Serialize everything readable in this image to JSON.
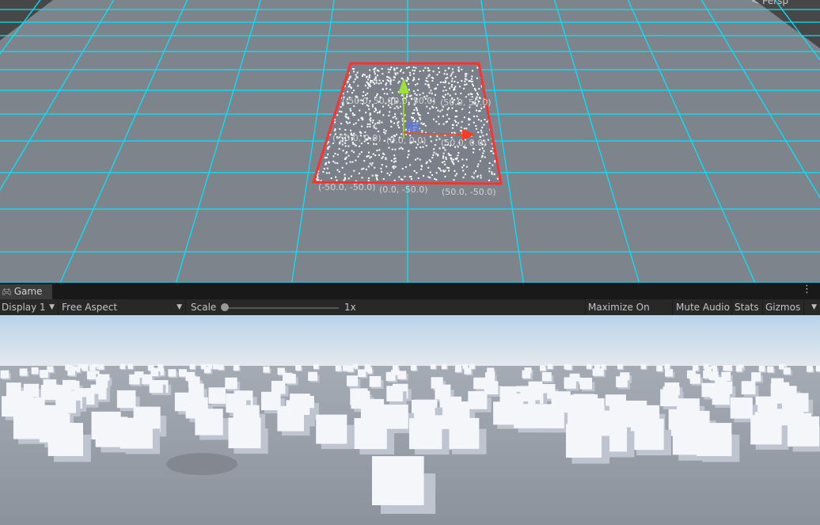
{
  "scene": {
    "view_mode_label": "< Persp",
    "coordinate_labels": [
      "(-50.0, 50.0)",
      "(0.0, 50.0)",
      "(50.0, 50.0)",
      "(-50.0, 0.0)",
      "(0.0, 0.0)",
      "(50.0, 0.0)",
      "(-50.0, -50.0)",
      "(0.0, -50.0)",
      "(50.0, -50.0)"
    ],
    "colors": {
      "grid_line": "#00e5ff",
      "bounds": "#ff3030",
      "plane": "#7e848c",
      "background": "#474747"
    }
  },
  "game_panel": {
    "tab_label": "Game",
    "tab_icon": "gamepad-icon",
    "display": "Display 1",
    "aspect": "Free Aspect",
    "scale_label": "Scale",
    "scale_value": "1x",
    "scale_fraction": 0.0,
    "maximize_on_play": "Maximize On Play",
    "mute_audio": "Mute Audio",
    "stats": "Stats",
    "gizmos": "Gizmos"
  }
}
